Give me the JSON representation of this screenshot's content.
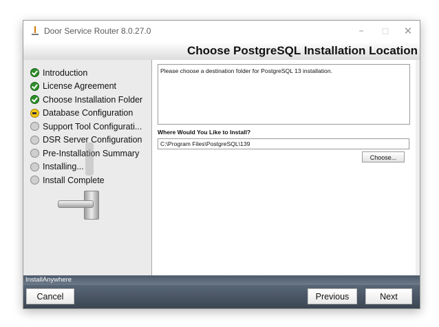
{
  "window": {
    "title": "Door Service Router 8.0.27.0",
    "controls": {
      "minimize": "–",
      "maximize": "□",
      "close": "✕"
    }
  },
  "header": {
    "title": "Choose PostgreSQL Installation Location"
  },
  "sidebar": {
    "steps": [
      {
        "label": "Introduction",
        "status": "done"
      },
      {
        "label": "License Agreement",
        "status": "done"
      },
      {
        "label": "Choose Installation Folder",
        "status": "done"
      },
      {
        "label": "Database Configuration",
        "status": "current"
      },
      {
        "label": "Support Tool Configurati...",
        "status": "pending"
      },
      {
        "label": "DSR Server Configuration",
        "status": "pending"
      },
      {
        "label": "Pre-Installation Summary",
        "status": "pending"
      },
      {
        "label": "Installing...",
        "status": "pending"
      },
      {
        "label": "Install Complete",
        "status": "pending"
      }
    ]
  },
  "main": {
    "description": "Please choose a destination folder for PostgreSQL 13 installation.",
    "install_label": "Where Would You Like to Install?",
    "install_path": "C:\\Program Files\\PostgreSQL\\139",
    "choose_label": "Choose..."
  },
  "footer": {
    "brand": "InstallAnywhere",
    "cancel_label": "Cancel",
    "previous_label": "Previous",
    "next_label": "Next"
  },
  "colors": {
    "step_done": "#2f8f2a",
    "step_current": "#f2c414",
    "step_pending": "#cfcfcf",
    "footer_bg": "#4a5563"
  }
}
